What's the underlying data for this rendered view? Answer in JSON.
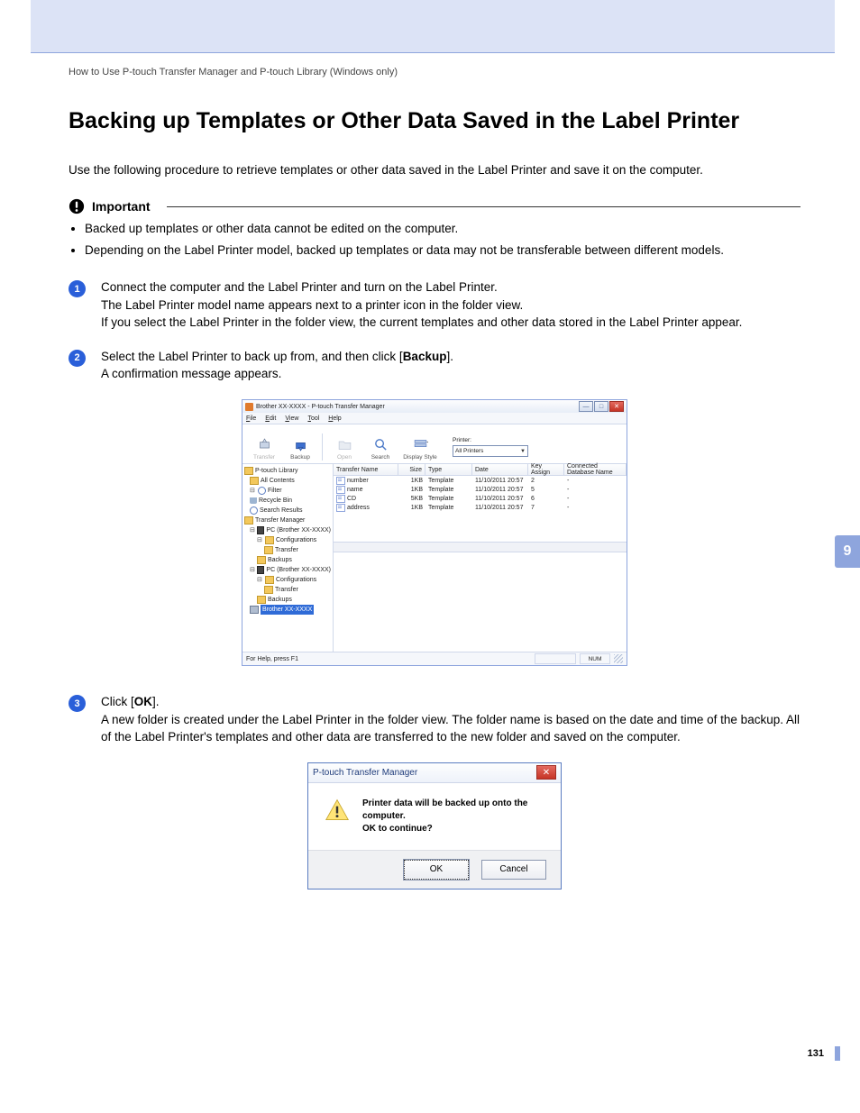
{
  "breadcrumb": "How to Use P-touch Transfer Manager and P-touch Library (Windows only)",
  "h1": "Backing up Templates or Other Data Saved in the Label Printer",
  "intro": "Use the following procedure to retrieve templates or other data saved in the Label Printer and save it on the computer.",
  "important": {
    "title": "Important",
    "b1": "Backed up templates or other data cannot be edited on the computer.",
    "b2": "Depending on the Label Printer model, backed up templates or data may not be transferable between different models."
  },
  "steps": {
    "s1": {
      "num": "1",
      "l1": "Connect the computer and the Label Printer and turn on the Label Printer.",
      "l2": "The Label Printer model name appears next to a printer icon in the folder view.",
      "l3": "If you select the Label Printer in the folder view, the current templates and other data stored in the Label Printer appear."
    },
    "s2": {
      "num": "2",
      "pre": "Select the Label Printer to back up from, and then click [",
      "bold": "Backup",
      "post": "].",
      "l2": "A confirmation message appears."
    },
    "s3": {
      "num": "3",
      "pre": "Click [",
      "bold": "OK",
      "post": "].",
      "l2": "A new folder is created under the Label Printer in the folder view. The folder name is based on the date and time of the backup. All of the Label Printer's templates and other data are transferred to the new folder and saved on the computer."
    }
  },
  "win": {
    "title": "Brother XX-XXXX - P-touch Transfer Manager",
    "menu": {
      "file": "File",
      "edit": "Edit",
      "view": "View",
      "tool": "Tool",
      "help": "Help"
    },
    "tb": {
      "transfer": "Transfer",
      "backup": "Backup",
      "open": "Open",
      "search": "Search",
      "display": "Display Style"
    },
    "printerLabel": "Printer:",
    "printerSel": "All Printers",
    "cols": {
      "name": "Transfer Name",
      "size": "Size",
      "type": "Type",
      "date": "Date",
      "key": "Key Assign",
      "db": "Connected Database Name"
    },
    "tree": {
      "root": "P-touch Library",
      "all": "All Contents",
      "filter": "Filter",
      "recycle": "Recycle Bin",
      "search": "Search Results",
      "tm": "Transfer Manager",
      "pc1": "PC (Brother XX-XXXX)",
      "pc2": "PC (Brother XX-XXXX)",
      "cfg": "Configurations",
      "transfer": "Transfer",
      "backups": "Backups",
      "sel": "Brother XX-XXXX"
    },
    "rows": [
      {
        "name": "number",
        "size": "1KB",
        "type": "Template",
        "date": "11/10/2011 20:57",
        "key": "2",
        "db": "-"
      },
      {
        "name": "name",
        "size": "1KB",
        "type": "Template",
        "date": "11/10/2011 20:57",
        "key": "5",
        "db": "-"
      },
      {
        "name": "CD",
        "size": "5KB",
        "type": "Template",
        "date": "11/10/2011 20:57",
        "key": "6",
        "db": "-"
      },
      {
        "name": "address",
        "size": "1KB",
        "type": "Template",
        "date": "11/10/2011 20:57",
        "key": "7",
        "db": "-"
      }
    ],
    "status": "For Help, press F1",
    "num": "NUM"
  },
  "dlg": {
    "title": "P-touch Transfer Manager",
    "l1": "Printer data will be backed up onto the computer.",
    "l2": "OK to continue?",
    "ok": "OK",
    "cancel": "Cancel"
  },
  "sideTab": "9",
  "pageNum": "131"
}
